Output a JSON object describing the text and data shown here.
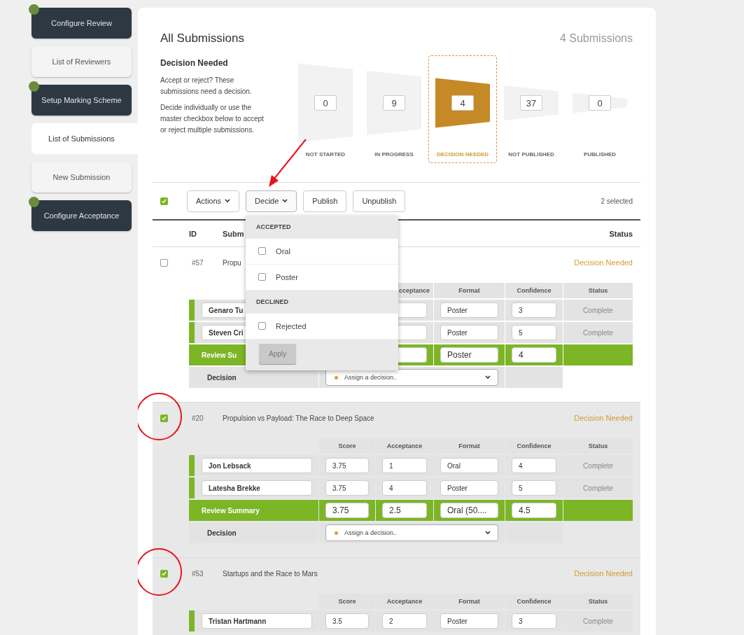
{
  "sidebar": {
    "items": [
      {
        "label": "Configure Review",
        "done": true,
        "selected": false
      },
      {
        "label": "List of Reviewers",
        "done": false,
        "selected": false
      },
      {
        "label": "Setup Marking Scheme",
        "done": true,
        "selected": false
      },
      {
        "label": "List of Submissions",
        "done": false,
        "selected": true
      },
      {
        "label": "New Submission",
        "done": false,
        "selected": false
      },
      {
        "label": "Configure Acceptance",
        "done": true,
        "selected": false
      }
    ]
  },
  "header": {
    "title": "All Submissions",
    "count": "4 Submissions"
  },
  "intro": {
    "heading": "Decision Needed",
    "paragraphs": [
      "Accept or reject? These submissions need a decision.",
      "Decide individually or use the master checkbox below to accept or reject multiple submissions."
    ]
  },
  "funnel": [
    {
      "count": "0",
      "label": "NOT STARTED",
      "selected": false
    },
    {
      "count": "9",
      "label": "IN PROGRESS",
      "selected": false
    },
    {
      "count": "4",
      "label": "DECISION NEEDED",
      "selected": true
    },
    {
      "count": "37",
      "label": "NOT PUBLISHED",
      "selected": false
    },
    {
      "count": "0",
      "label": "PUBLISHED",
      "selected": false
    }
  ],
  "toolbar": {
    "master_checked": true,
    "selection": "2 selected",
    "annotation_arrow": true,
    "buttons": [
      {
        "label": "Actions",
        "dropdown": true,
        "open": false
      },
      {
        "label": "Decide",
        "dropdown": true,
        "open": true
      },
      {
        "label": "Publish",
        "dropdown": false,
        "open": false
      },
      {
        "label": "Unpublish",
        "dropdown": false,
        "open": false
      }
    ]
  },
  "decide_menu": {
    "groups": [
      {
        "heading": "ACCEPTED",
        "options": [
          {
            "label": "Oral",
            "checked": false
          },
          {
            "label": "Poster",
            "checked": false
          }
        ]
      },
      {
        "heading": "DECLINED",
        "options": [
          {
            "label": "Rejected",
            "checked": false
          }
        ]
      }
    ],
    "apply": {
      "label": "Apply",
      "disabled": true
    }
  },
  "columns": {
    "id": "ID",
    "title": "Subm",
    "status": "Status"
  },
  "submissions": [
    {
      "checked": false,
      "circled": false,
      "id": "#57",
      "title": "Propu",
      "status": "Decision Needed",
      "review_header": {
        "acceptance": "cceptance",
        "format": "Format",
        "confidence": "Confidence",
        "status": "Status"
      },
      "reviews": [
        {
          "name": "Genaro Tu",
          "format": "Poster",
          "confidence": "3",
          "status": "Complete"
        },
        {
          "name": "Steven Cri",
          "format": "Poster",
          "confidence": "5",
          "status": "Complete"
        }
      ],
      "summary": {
        "label": "Review Su",
        "format": "Poster",
        "confidence": "4"
      },
      "decision": {
        "label": "Decision",
        "value": "Assign a decision.."
      }
    },
    {
      "checked": true,
      "circled": true,
      "id": "#20",
      "title": "Propulsion vs Payload: The Race to Deep Space",
      "status": "Decision Needed",
      "review_header": {
        "score": "Score",
        "acceptance": "Acceptance",
        "format": "Format",
        "confidence": "Confidence",
        "status": "Status"
      },
      "reviews": [
        {
          "name": "Jon Lebsack",
          "score": "3.75",
          "acceptance": "1",
          "format": "Oral",
          "confidence": "4",
          "status": "Complete"
        },
        {
          "name": "Latesha Brekke",
          "score": "3.75",
          "acceptance": "4",
          "format": "Poster",
          "confidence": "5",
          "status": "Complete"
        }
      ],
      "summary": {
        "label": "Review Summary",
        "score": "3.75",
        "acceptance": "2.5",
        "format": "Oral (50....",
        "confidence": "4.5"
      },
      "decision": {
        "label": "Decision",
        "value": "Assign a decision.."
      }
    },
    {
      "checked": true,
      "circled": true,
      "id": "#53",
      "title": "Startups and the Race to Mars",
      "status": "Decision Needed",
      "review_header": {
        "score": "Score",
        "acceptance": "Acceptance",
        "format": "Format",
        "confidence": "Confidence",
        "status": "Status"
      },
      "reviews": [
        {
          "name": "Tristan Hartmann",
          "score": "3.5",
          "acceptance": "2",
          "format": "Poster",
          "confidence": "3",
          "status": "Complete"
        }
      ]
    }
  ]
}
